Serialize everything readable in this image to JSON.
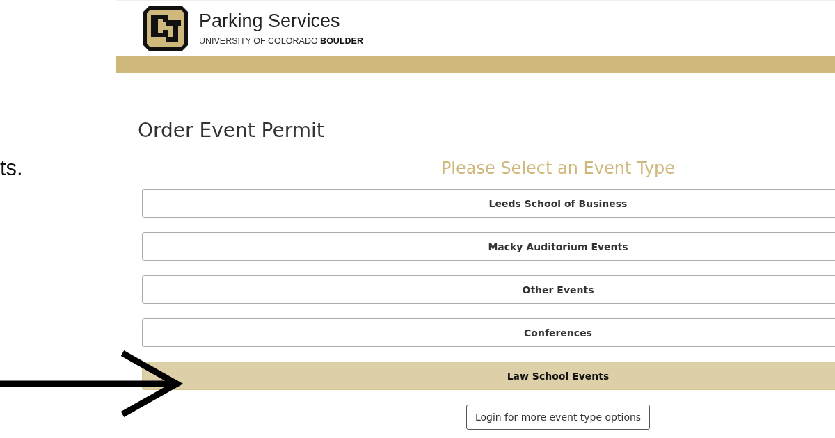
{
  "slide_text": "ts.",
  "header": {
    "title": "Parking Services",
    "subtitle_plain": "UNIVERSITY OF COLORADO",
    "subtitle_bold": "BOULDER"
  },
  "page_title": "Order Event Permit",
  "prompt": "Please Select an Event Type",
  "event_types": [
    {
      "label": "Leeds School of Business",
      "selected": false
    },
    {
      "label": "Macky Auditorium Events",
      "selected": false
    },
    {
      "label": "Other Events",
      "selected": false
    },
    {
      "label": "Conferences",
      "selected": false
    },
    {
      "label": "Law School Events",
      "selected": true
    }
  ],
  "login_button": "Login for more event type options"
}
